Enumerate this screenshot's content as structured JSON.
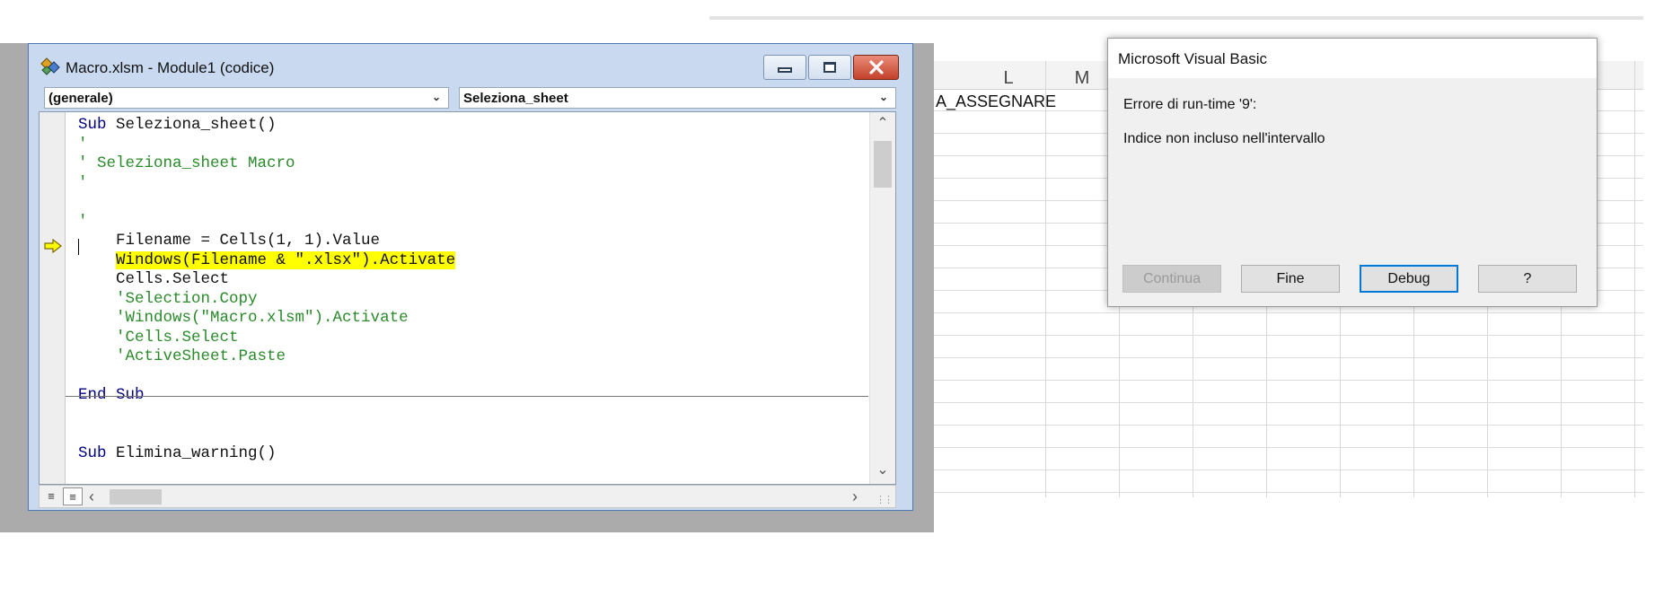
{
  "excel": {
    "columns": [
      "L",
      "M"
    ],
    "cell_text": "A_ASSEGNARE"
  },
  "code_window": {
    "title": "Macro.xlsm - Module1 (codice)",
    "app_icon": "vbe-module-icon",
    "object_combo": "(generale)",
    "procedure_combo": "Seleziona_sheet",
    "execution_pointer_icon": "yellow-arrow-icon",
    "lines": [
      {
        "parts": [
          {
            "t": "Sub",
            "c": "kw"
          },
          {
            "t": " Seleziona_sheet()",
            "c": ""
          }
        ]
      },
      {
        "parts": [
          {
            "t": "'",
            "c": "cm"
          }
        ]
      },
      {
        "parts": [
          {
            "t": "' Seleziona_sheet Macro",
            "c": "cm"
          }
        ]
      },
      {
        "parts": [
          {
            "t": "'",
            "c": "cm"
          }
        ]
      },
      {
        "parts": [
          {
            "t": "",
            "c": ""
          }
        ]
      },
      {
        "parts": [
          {
            "t": "'",
            "c": "cm"
          }
        ]
      },
      {
        "parts": [
          {
            "t": "    Filename = Cells(1, 1).Value",
            "c": ""
          }
        ]
      },
      {
        "parts": [
          {
            "t": "    ",
            "c": ""
          },
          {
            "t": "Windows(Filename & \".xlsx\").Activate",
            "c": "hl"
          }
        ]
      },
      {
        "parts": [
          {
            "t": "    Cells.Select",
            "c": ""
          }
        ]
      },
      {
        "parts": [
          {
            "t": "    ",
            "c": ""
          },
          {
            "t": "'Selection.Copy",
            "c": "cm"
          }
        ]
      },
      {
        "parts": [
          {
            "t": "    ",
            "c": ""
          },
          {
            "t": "'Windows(\"Macro.xlsm\").Activate",
            "c": "cm"
          }
        ]
      },
      {
        "parts": [
          {
            "t": "    ",
            "c": ""
          },
          {
            "t": "'Cells.Select",
            "c": "cm"
          }
        ]
      },
      {
        "parts": [
          {
            "t": "    ",
            "c": ""
          },
          {
            "t": "'ActiveSheet.Paste",
            "c": "cm"
          }
        ]
      },
      {
        "parts": [
          {
            "t": "",
            "c": ""
          }
        ]
      },
      {
        "parts": [
          {
            "t": "End Sub",
            "c": "kw"
          }
        ]
      },
      {
        "parts": [
          {
            "t": "",
            "c": ""
          }
        ]
      },
      {
        "parts": [
          {
            "t": "",
            "c": ""
          }
        ]
      },
      {
        "parts": [
          {
            "t": "Sub",
            "c": "kw"
          },
          {
            "t": " Elimina_warning()",
            "c": ""
          }
        ]
      }
    ]
  },
  "dialog": {
    "title": "Microsoft Visual Basic",
    "error_title": "Errore di run-time '9':",
    "error_message": "Indice non incluso nell'intervallo",
    "buttons": {
      "continue": "Continua",
      "end": "Fine",
      "debug": "Debug",
      "help": "?"
    }
  },
  "colors": {
    "keyword": "#00007f",
    "comment": "#2a8a2a",
    "highlight": "#ffff00",
    "default_button_border": "#0078d7"
  }
}
